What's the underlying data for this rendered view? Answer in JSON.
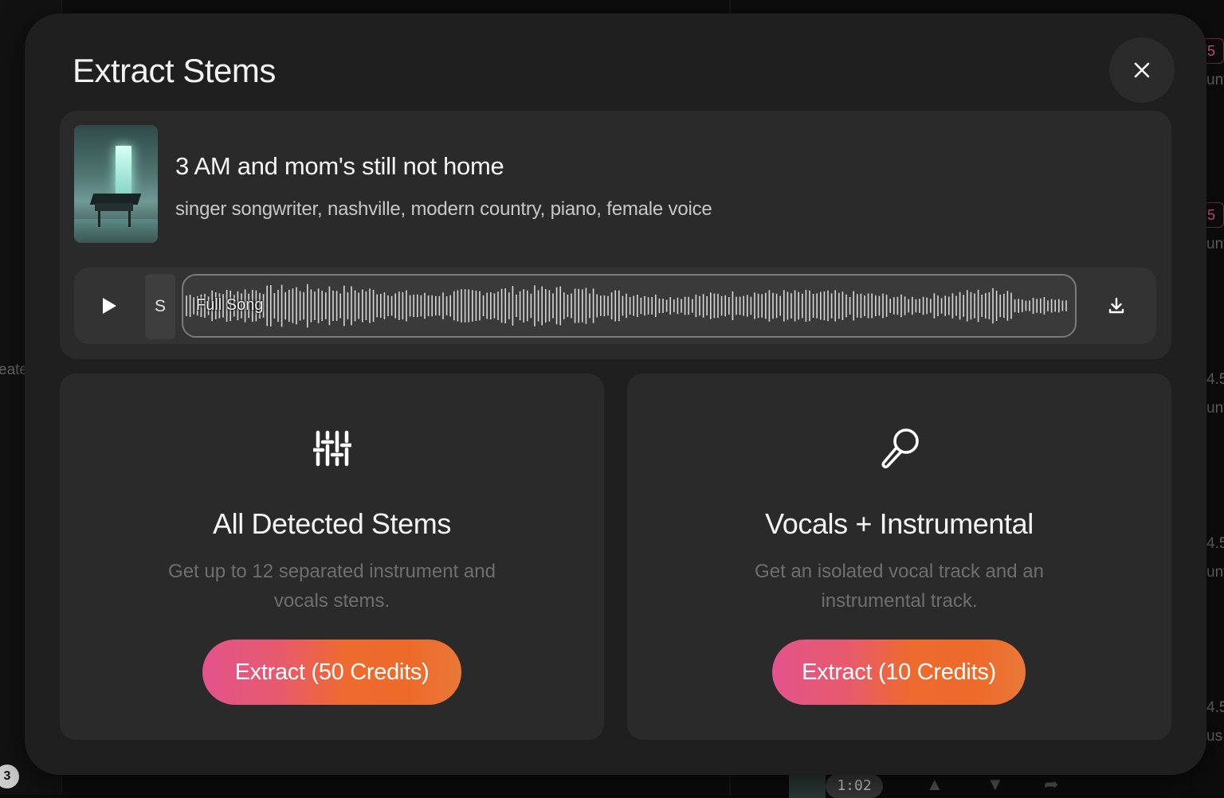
{
  "background": {
    "left_text": "eate",
    "badges": [
      "5",
      "5"
    ],
    "side_labels": [
      "4.5",
      "4.5",
      "4.5"
    ],
    "side_fragments": [
      "unt",
      "unt",
      "unt",
      "unt",
      "us"
    ],
    "corner_count": "3",
    "duration": "1:02"
  },
  "modal": {
    "title": "Extract Stems",
    "close_icon": "close-icon"
  },
  "song": {
    "title": "3 AM and mom's still not home",
    "tags": "singer songwriter, nashville, modern country, piano, female voice"
  },
  "player": {
    "s_label": "S",
    "track_label": "Full Song"
  },
  "options": [
    {
      "icon": "sliders-icon",
      "title": "All Detected Stems",
      "description": "Get up to 12 separated instrument and vocals stems.",
      "button": "Extract (50 Credits)"
    },
    {
      "icon": "microphone-icon",
      "title": "Vocals + Instrumental",
      "description": "Get an isolated vocal track and an instrumental track.",
      "button": "Extract (10 Credits)"
    }
  ],
  "colors": {
    "modal_bg": "#1f1f20",
    "card_bg": "#2a2a2b",
    "button_gradient_start": "#e2548c",
    "button_gradient_end": "#ee6a2a"
  }
}
